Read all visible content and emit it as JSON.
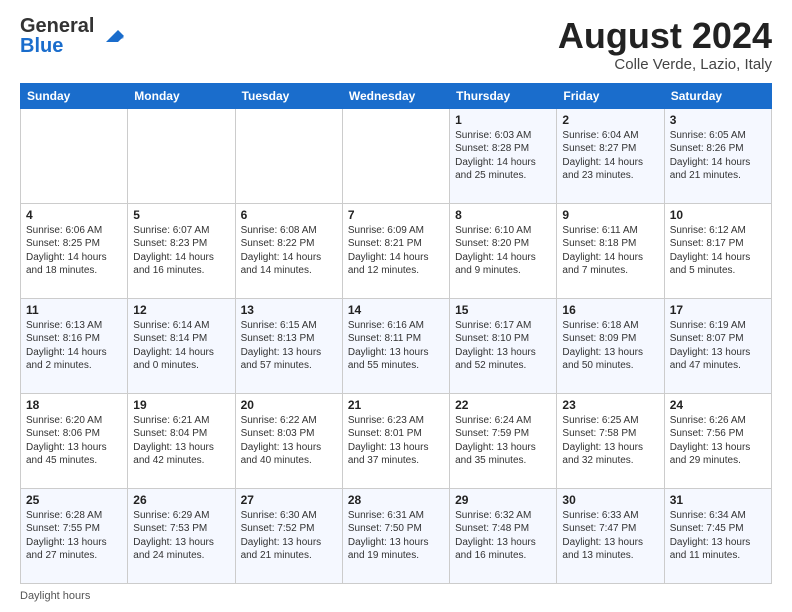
{
  "header": {
    "logo_line1": "General",
    "logo_line2": "Blue",
    "month_title": "August 2024",
    "location": "Colle Verde, Lazio, Italy"
  },
  "days_of_week": [
    "Sunday",
    "Monday",
    "Tuesday",
    "Wednesday",
    "Thursday",
    "Friday",
    "Saturday"
  ],
  "weeks": [
    [
      {
        "num": "",
        "info": ""
      },
      {
        "num": "",
        "info": ""
      },
      {
        "num": "",
        "info": ""
      },
      {
        "num": "",
        "info": ""
      },
      {
        "num": "1",
        "info": "Sunrise: 6:03 AM\nSunset: 8:28 PM\nDaylight: 14 hours and 25 minutes."
      },
      {
        "num": "2",
        "info": "Sunrise: 6:04 AM\nSunset: 8:27 PM\nDaylight: 14 hours and 23 minutes."
      },
      {
        "num": "3",
        "info": "Sunrise: 6:05 AM\nSunset: 8:26 PM\nDaylight: 14 hours and 21 minutes."
      }
    ],
    [
      {
        "num": "4",
        "info": "Sunrise: 6:06 AM\nSunset: 8:25 PM\nDaylight: 14 hours and 18 minutes."
      },
      {
        "num": "5",
        "info": "Sunrise: 6:07 AM\nSunset: 8:23 PM\nDaylight: 14 hours and 16 minutes."
      },
      {
        "num": "6",
        "info": "Sunrise: 6:08 AM\nSunset: 8:22 PM\nDaylight: 14 hours and 14 minutes."
      },
      {
        "num": "7",
        "info": "Sunrise: 6:09 AM\nSunset: 8:21 PM\nDaylight: 14 hours and 12 minutes."
      },
      {
        "num": "8",
        "info": "Sunrise: 6:10 AM\nSunset: 8:20 PM\nDaylight: 14 hours and 9 minutes."
      },
      {
        "num": "9",
        "info": "Sunrise: 6:11 AM\nSunset: 8:18 PM\nDaylight: 14 hours and 7 minutes."
      },
      {
        "num": "10",
        "info": "Sunrise: 6:12 AM\nSunset: 8:17 PM\nDaylight: 14 hours and 5 minutes."
      }
    ],
    [
      {
        "num": "11",
        "info": "Sunrise: 6:13 AM\nSunset: 8:16 PM\nDaylight: 14 hours and 2 minutes."
      },
      {
        "num": "12",
        "info": "Sunrise: 6:14 AM\nSunset: 8:14 PM\nDaylight: 14 hours and 0 minutes."
      },
      {
        "num": "13",
        "info": "Sunrise: 6:15 AM\nSunset: 8:13 PM\nDaylight: 13 hours and 57 minutes."
      },
      {
        "num": "14",
        "info": "Sunrise: 6:16 AM\nSunset: 8:11 PM\nDaylight: 13 hours and 55 minutes."
      },
      {
        "num": "15",
        "info": "Sunrise: 6:17 AM\nSunset: 8:10 PM\nDaylight: 13 hours and 52 minutes."
      },
      {
        "num": "16",
        "info": "Sunrise: 6:18 AM\nSunset: 8:09 PM\nDaylight: 13 hours and 50 minutes."
      },
      {
        "num": "17",
        "info": "Sunrise: 6:19 AM\nSunset: 8:07 PM\nDaylight: 13 hours and 47 minutes."
      }
    ],
    [
      {
        "num": "18",
        "info": "Sunrise: 6:20 AM\nSunset: 8:06 PM\nDaylight: 13 hours and 45 minutes."
      },
      {
        "num": "19",
        "info": "Sunrise: 6:21 AM\nSunset: 8:04 PM\nDaylight: 13 hours and 42 minutes."
      },
      {
        "num": "20",
        "info": "Sunrise: 6:22 AM\nSunset: 8:03 PM\nDaylight: 13 hours and 40 minutes."
      },
      {
        "num": "21",
        "info": "Sunrise: 6:23 AM\nSunset: 8:01 PM\nDaylight: 13 hours and 37 minutes."
      },
      {
        "num": "22",
        "info": "Sunrise: 6:24 AM\nSunset: 7:59 PM\nDaylight: 13 hours and 35 minutes."
      },
      {
        "num": "23",
        "info": "Sunrise: 6:25 AM\nSunset: 7:58 PM\nDaylight: 13 hours and 32 minutes."
      },
      {
        "num": "24",
        "info": "Sunrise: 6:26 AM\nSunset: 7:56 PM\nDaylight: 13 hours and 29 minutes."
      }
    ],
    [
      {
        "num": "25",
        "info": "Sunrise: 6:28 AM\nSunset: 7:55 PM\nDaylight: 13 hours and 27 minutes."
      },
      {
        "num": "26",
        "info": "Sunrise: 6:29 AM\nSunset: 7:53 PM\nDaylight: 13 hours and 24 minutes."
      },
      {
        "num": "27",
        "info": "Sunrise: 6:30 AM\nSunset: 7:52 PM\nDaylight: 13 hours and 21 minutes."
      },
      {
        "num": "28",
        "info": "Sunrise: 6:31 AM\nSunset: 7:50 PM\nDaylight: 13 hours and 19 minutes."
      },
      {
        "num": "29",
        "info": "Sunrise: 6:32 AM\nSunset: 7:48 PM\nDaylight: 13 hours and 16 minutes."
      },
      {
        "num": "30",
        "info": "Sunrise: 6:33 AM\nSunset: 7:47 PM\nDaylight: 13 hours and 13 minutes."
      },
      {
        "num": "31",
        "info": "Sunrise: 6:34 AM\nSunset: 7:45 PM\nDaylight: 13 hours and 11 minutes."
      }
    ]
  ],
  "footer": {
    "daylight_label": "Daylight hours"
  }
}
